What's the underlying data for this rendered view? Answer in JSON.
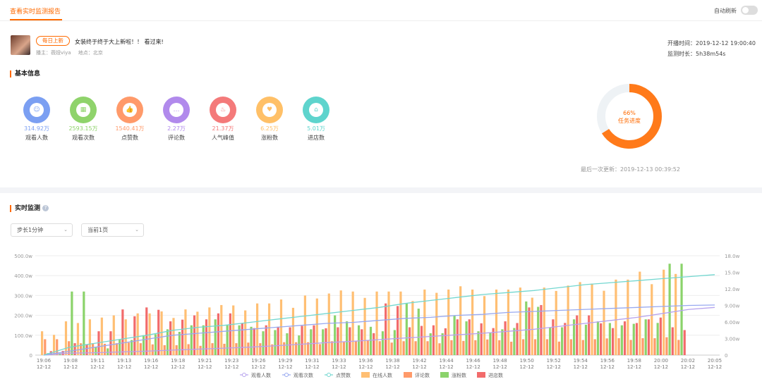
{
  "tab": {
    "label": "查看实时监测报告"
  },
  "auto_refresh": {
    "label": "自动刷新",
    "enabled": false
  },
  "stream": {
    "badge": "每日上新",
    "title": "女装终于终于大上新啦！！ 看过来!",
    "host": "播主：薇娅viya",
    "location": "地点：北京",
    "start_time": "开播时间：2019-12-12 19:00:40",
    "duration": "监测时长：5h38m54s"
  },
  "basic_info": {
    "title": "基本信息",
    "stats": [
      {
        "value": "314.92万",
        "label": "观看人数",
        "color": "#7b9ff2",
        "icon": "user-icon",
        "glyph": "☺"
      },
      {
        "value": "2593.15万",
        "label": "观看次数",
        "color": "#8fd36b",
        "icon": "grid-icon",
        "glyph": "▦"
      },
      {
        "value": "1540.41万",
        "label": "点赞数",
        "color": "#ff9a6a",
        "icon": "thumb-up-icon",
        "glyph": "👍"
      },
      {
        "value": "2.27万",
        "label": "评论数",
        "color": "#b18aec",
        "icon": "comment-icon",
        "glyph": "…"
      },
      {
        "value": "21.37万",
        "label": "人气峰值",
        "color": "#f47a7a",
        "icon": "fire-icon",
        "glyph": "♨"
      },
      {
        "value": "6.25万",
        "label": "涨粉数",
        "color": "#ffc067",
        "icon": "heart-icon",
        "glyph": "♥"
      },
      {
        "value": "5.01万",
        "label": "进店数",
        "color": "#5ed4cd",
        "icon": "store-icon",
        "glyph": "⌂"
      }
    ],
    "progress": {
      "percent": 66,
      "percent_label": "66%",
      "label": "任务进度",
      "color": "#ff7a1a"
    },
    "last_update": "最后一次更新：2019-12-13 00:39:52"
  },
  "realtime": {
    "title": "实时监测",
    "step_select": "步长1分钟",
    "page_select": "当前1页"
  },
  "chart_data": {
    "type": "bar",
    "x_ticks": [
      "19:06\n12-12",
      "19:08\n12-12",
      "19:11\n12-12",
      "19:13\n12-12",
      "19:16\n12-12",
      "19:18\n12-12",
      "19:21\n12-12",
      "19:23\n12-12",
      "19:26\n12-12",
      "19:29\n12-12",
      "19:31\n12-12",
      "19:33\n12-12",
      "19:36\n12-12",
      "19:38\n12-12",
      "19:42\n12-12",
      "19:44\n12-12",
      "19:46\n12-12",
      "19:48\n12-12",
      "19:50\n12-12",
      "19:52\n12-12",
      "19:54\n12-12",
      "19:56\n12-12",
      "19:58\n12-12",
      "20:00\n12-12",
      "20:02\n12-12",
      "20:05\n12-12"
    ],
    "y_left_ticks": [
      "0",
      "100.0w",
      "200.0w",
      "300.0w",
      "400.0w",
      "500.0w"
    ],
    "y_right_ticks": [
      "0",
      "3.00w",
      "6.00w",
      "9.00w",
      "12.0w",
      "15.0w",
      "18.0w"
    ],
    "ylim_left": [
      0,
      500
    ],
    "ylim_right": [
      0,
      18
    ],
    "series": [
      {
        "name": "观看人数",
        "kind": "line",
        "color": "#b7a3ee",
        "values": [
          0,
          10,
          12,
          16,
          20,
          25,
          30,
          35,
          40,
          47,
          55,
          63,
          70,
          78,
          86,
          94,
          102,
          110,
          120,
          130,
          145,
          160,
          175,
          190,
          210,
          230,
          240
        ]
      },
      {
        "name": "观看次数",
        "kind": "line",
        "color": "#98a9f0",
        "values": [
          0,
          20,
          40,
          60,
          80,
          100,
          110,
          120,
          130,
          140,
          150,
          160,
          165,
          175,
          185,
          190,
          200,
          205,
          215,
          220,
          225,
          230,
          235,
          240,
          245,
          250,
          252
        ]
      },
      {
        "name": "点赞数",
        "kind": "line",
        "color": "#73d7d0",
        "values": [
          0,
          40,
          60,
          80,
          100,
          125,
          140,
          150,
          165,
          180,
          195,
          210,
          225,
          240,
          260,
          275,
          290,
          305,
          315,
          325,
          340,
          355,
          365,
          375,
          385,
          395,
          405
        ]
      },
      {
        "name": "在线人数",
        "kind": "bar",
        "color": "#ffbf73",
        "values": [
          120,
          170,
          180,
          200,
          210,
          220,
          230,
          240,
          250,
          260,
          280,
          300,
          310,
          320,
          320,
          320,
          330,
          330,
          330,
          330,
          340,
          340,
          350,
          360,
          380,
          420,
          430
        ]
      },
      {
        "name": "评论数",
        "kind": "bar",
        "color": "#ff9a6a",
        "values": [
          80,
          70,
          60,
          60,
          60,
          50,
          55,
          60,
          60,
          60,
          65,
          65,
          70,
          70,
          70,
          70,
          70,
          75,
          75,
          75,
          80,
          80,
          80,
          80,
          85,
          85,
          90
        ]
      },
      {
        "name": "涨粉数",
        "kind": "bar",
        "color": "#8bd36b",
        "values": [
          10,
          320,
          40,
          80,
          100,
          130,
          150,
          180,
          150,
          120,
          110,
          130,
          200,
          150,
          120,
          260,
          110,
          200,
          120,
          130,
          270,
          140,
          180,
          170,
          150,
          180,
          460
        ]
      },
      {
        "name": "进店数",
        "kind": "bar",
        "color": "#f26b6b",
        "values": [
          20,
          60,
          120,
          230,
          240,
          170,
          200,
          210,
          160,
          150,
          140,
          150,
          140,
          130,
          260,
          140,
          150,
          180,
          160,
          170,
          240,
          180,
          200,
          160,
          170,
          180,
          140
        ]
      }
    ]
  }
}
